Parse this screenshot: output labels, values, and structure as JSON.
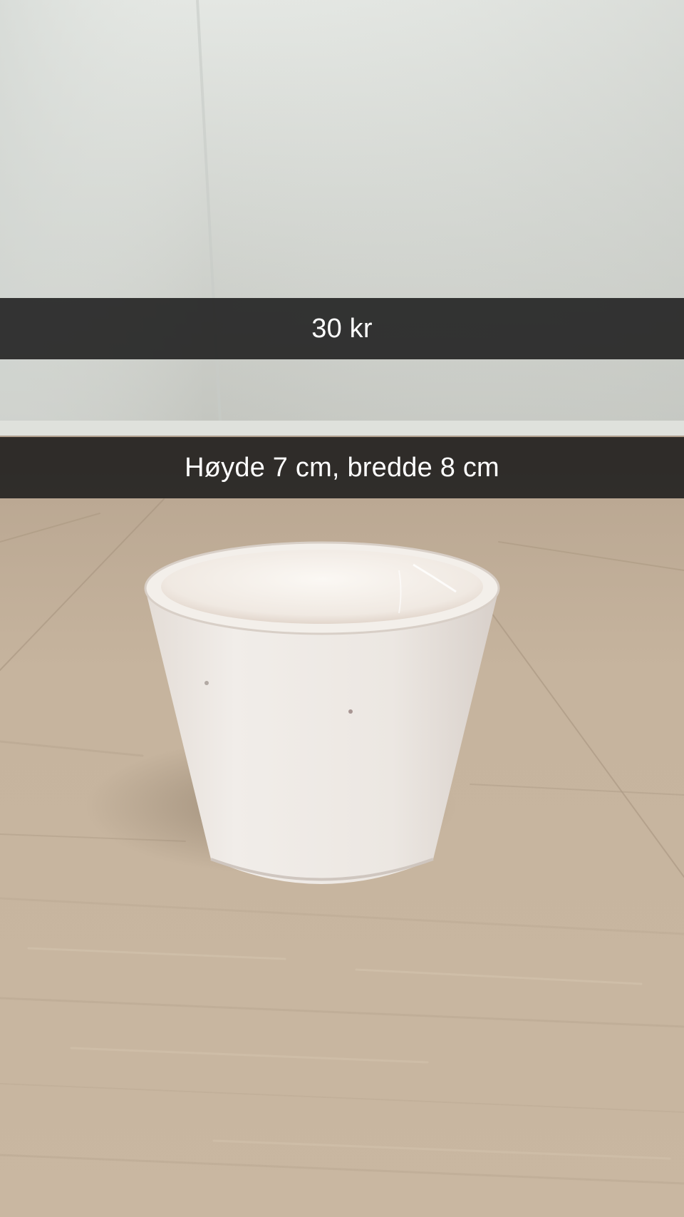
{
  "captions": {
    "price": "30 kr",
    "dimensions": "Høyde 7 cm, bredde 8 cm"
  },
  "scene": {
    "subject": "white-ceramic-pot",
    "wall_color": "#d8dbd6",
    "floor_color": "#c4b29c",
    "pot_color": "#efebe6",
    "caption_bar_color": "#181818"
  }
}
